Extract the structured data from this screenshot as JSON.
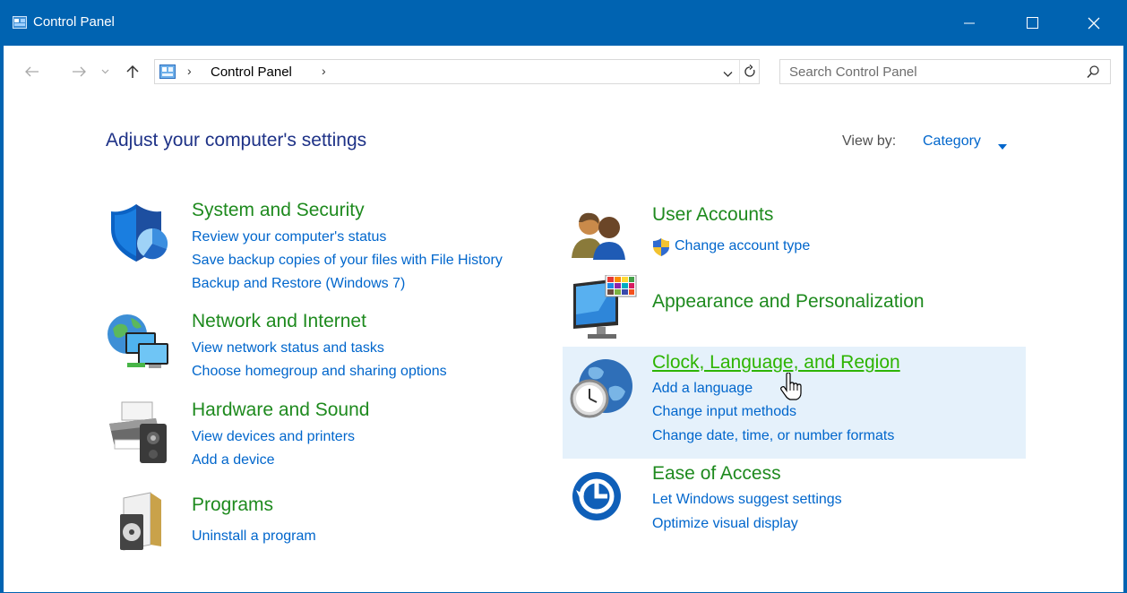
{
  "window": {
    "title": "Control Panel",
    "accent": "#0063b1"
  },
  "navigation": {
    "back_icon": "arrow-left-icon",
    "forward_icon": "arrow-right-icon",
    "recent_icon": "chevron-down-icon",
    "up_icon": "arrow-up-icon"
  },
  "address": {
    "separator": "›",
    "crumb": "Control Panel",
    "dropdown_icon": "chevron-down-icon",
    "refresh_icon": "refresh-icon"
  },
  "search": {
    "placeholder": "Search Control Panel",
    "value": "",
    "icon": "search-icon"
  },
  "header": {
    "title": "Adjust your computer's settings",
    "view_by_label": "View by:",
    "view_by_value": "Category"
  },
  "categories": {
    "system_security": {
      "title": "System and Security",
      "links": [
        "Review your computer's status",
        "Save backup copies of your files with File History",
        "Backup and Restore (Windows 7)"
      ]
    },
    "network_internet": {
      "title": "Network and Internet",
      "links": [
        "View network status and tasks",
        "Choose homegroup and sharing options"
      ]
    },
    "hardware_sound": {
      "title": "Hardware and Sound",
      "links": [
        "View devices and printers",
        "Add a device"
      ]
    },
    "programs": {
      "title": "Programs",
      "links": [
        "Uninstall a program"
      ]
    },
    "user_accounts": {
      "title": "User Accounts",
      "links": [
        "Change account type"
      ]
    },
    "appearance": {
      "title": "Appearance and Personalization",
      "links": []
    },
    "clock_region": {
      "title": "Clock, Language, and Region",
      "hovered": true,
      "links": [
        "Add a language",
        "Change input methods",
        "Change date, time, or number formats"
      ]
    },
    "ease_access": {
      "title": "Ease of Access",
      "links": [
        "Let Windows suggest settings",
        "Optimize visual display"
      ]
    }
  },
  "colors": {
    "category_title": "#1e8a1e",
    "link": "#0066cc",
    "heading": "#1e3287",
    "hover_background": "#e5f1fb"
  }
}
